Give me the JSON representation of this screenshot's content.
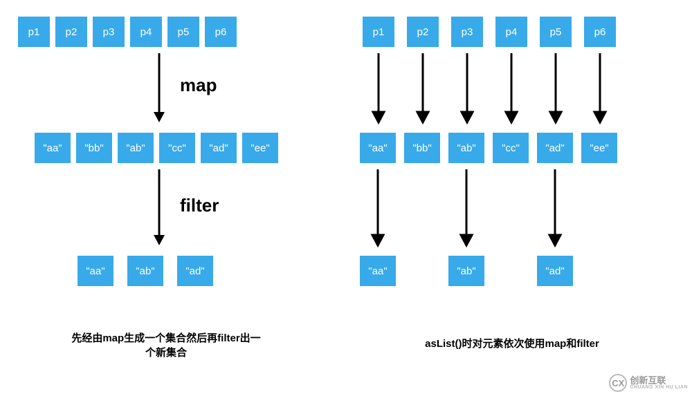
{
  "left": {
    "row1": [
      "p1",
      "p2",
      "p3",
      "p4",
      "p5",
      "p6"
    ],
    "op1": "map",
    "row2": [
      "\"aa\"",
      "\"bb\"",
      "\"ab\"",
      "\"cc\"",
      "\"ad\"",
      "\"ee\""
    ],
    "op2": "filter",
    "row3": [
      "\"aa\"",
      "\"ab\"",
      "\"ad\""
    ],
    "caption_line1": "先经由map生成一个集合然后再filter出一",
    "caption_line2": "个新集合"
  },
  "right": {
    "row1": [
      "p1",
      "p2",
      "p3",
      "p4",
      "p5",
      "p6"
    ],
    "row2": [
      "\"aa\"",
      "\"bb\"",
      "\"ab\"",
      "\"cc\"",
      "\"ad\"",
      "\"ee\""
    ],
    "row3": [
      "\"aa\"",
      "\"ab\"",
      "\"ad\""
    ],
    "caption": "asList()时对元素依次使用map和filter"
  },
  "watermark": {
    "brand": "创新互联",
    "sub": "CHUANG XIN HU LIAN",
    "logo": "CX"
  },
  "chart_data": {
    "type": "diagram",
    "title": "map/filter eager vs lazy sequence evaluation",
    "left_pipeline": {
      "description": "Apply map to whole collection producing intermediate collection, then apply filter to produce new collection",
      "input": [
        "p1",
        "p2",
        "p3",
        "p4",
        "p5",
        "p6"
      ],
      "after_map": [
        "aa",
        "bb",
        "ab",
        "cc",
        "ad",
        "ee"
      ],
      "after_filter": [
        "aa",
        "ab",
        "ad"
      ],
      "operations": [
        "map",
        "filter"
      ]
    },
    "right_pipeline": {
      "description": "asList() applies map and filter per-element in sequence (lazy)",
      "input": [
        "p1",
        "p2",
        "p3",
        "p4",
        "p5",
        "p6"
      ],
      "after_map": [
        "aa",
        "bb",
        "ab",
        "cc",
        "ad",
        "ee"
      ],
      "after_filter": [
        "aa",
        "ab",
        "ad"
      ],
      "filter_pass_indices": [
        0,
        2,
        4
      ]
    }
  }
}
